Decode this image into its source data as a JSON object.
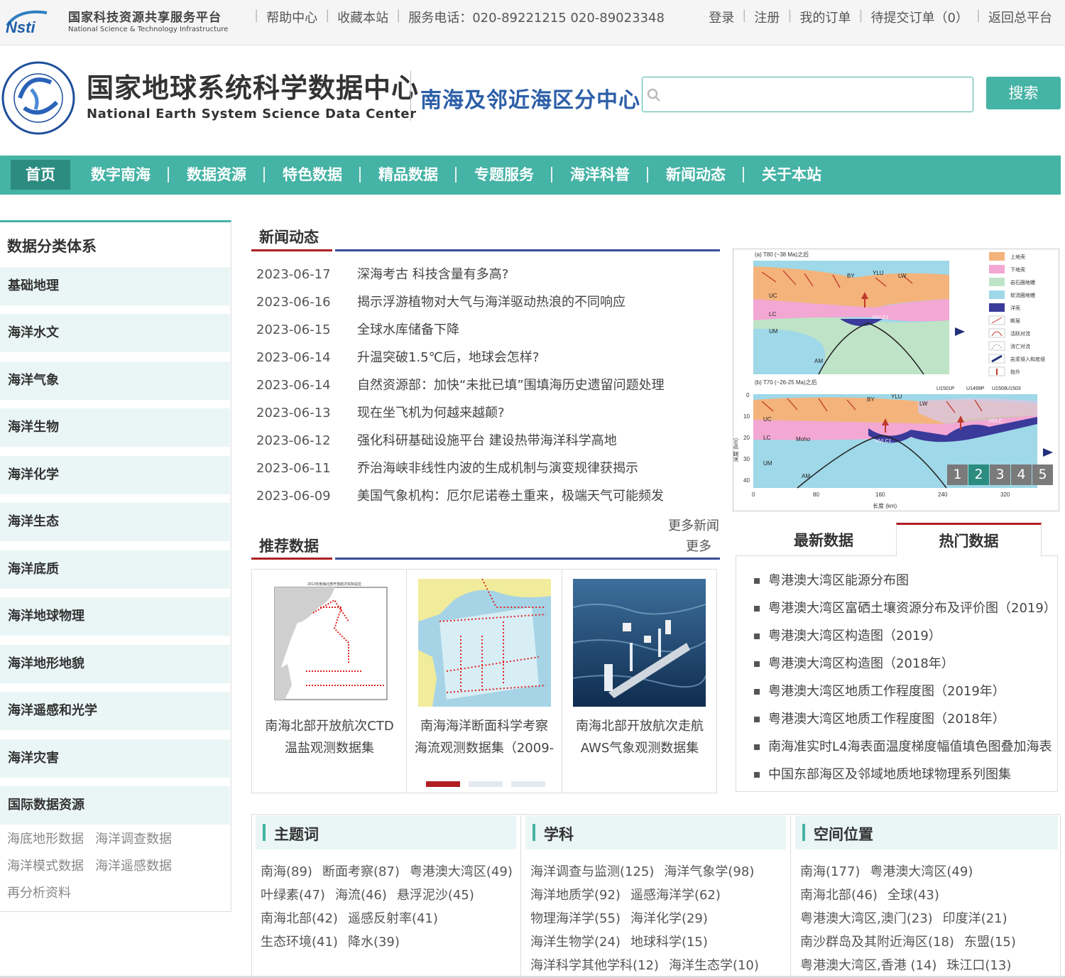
{
  "topbar": {
    "platform_cn": "国家科技资源共享服务平台",
    "platform_en": "National Science & Technology Infrastructure",
    "help": "帮助中心",
    "bookmark": "收藏本站",
    "phone": "服务电话：020-89221215 020-89023348",
    "login": "登录",
    "register": "注册",
    "my_orders": "我的订单",
    "pending_orders": "待提交订单（0）",
    "back_main": "返回总平台"
  },
  "header": {
    "title_cn": "国家地球系统科学数据中心",
    "title_en": "National Earth System Science Data Center",
    "sub_center": "南海及邻近海区分中心",
    "search_placeholder": "",
    "search_button": "搜索"
  },
  "nav": [
    "首页",
    "数字南海",
    "数据资源",
    "特色数据",
    "精品数据",
    "专题服务",
    "海洋科普",
    "新闻动态",
    "关于本站"
  ],
  "sidebar": {
    "title": "数据分类体系",
    "categories": [
      "基础地理",
      "海洋水文",
      "海洋气象",
      "海洋生物",
      "海洋化学",
      "海洋生态",
      "海洋底质",
      "海洋地球物理",
      "海洋地形地貌",
      "海洋遥感和光学",
      "海洋灾害",
      "国际数据资源"
    ],
    "intl_links": [
      [
        "海底地形数据",
        "海洋调查数据"
      ],
      [
        "海洋模式数据",
        "海洋遥感数据"
      ],
      [
        "再分析资料"
      ]
    ]
  },
  "news": {
    "title": "新闻动态",
    "more": "更多新闻",
    "items": [
      {
        "date": "2023-06-17",
        "title": "深海考古 科技含量有多高?"
      },
      {
        "date": "2023-06-16",
        "title": "揭示浮游植物对大气与海洋驱动热浪的不同响应"
      },
      {
        "date": "2023-06-15",
        "title": "全球水库储备下降"
      },
      {
        "date": "2023-06-14",
        "title": "升温突破1.5℃后，地球会怎样?"
      },
      {
        "date": "2023-06-14",
        "title": "自然资源部：加快“未批已填”围填海历史遗留问题处理"
      },
      {
        "date": "2023-06-13",
        "title": "现在坐飞机为何越来越颠?"
      },
      {
        "date": "2023-06-12",
        "title": "强化科研基础设施平台 建设热带海洋科学高地"
      },
      {
        "date": "2023-06-11",
        "title": "乔治海峡非线性内波的生成机制与演变规律获揭示"
      },
      {
        "date": "2023-06-09",
        "title": "美国气象机构：厄尔尼诺卷土重来，极端天气可能频发"
      }
    ]
  },
  "figure": {
    "panel_a": "(a) T80 (~38 Ma)之后",
    "panel_b": "(b) T70 (~26-25 Ma)之后",
    "labels_a": [
      "BY",
      "YLU",
      "LW",
      "UC",
      "LC",
      "UM",
      "HVLC1",
      "AM"
    ],
    "labels_b": [
      "BY",
      "YLU",
      "LW",
      "UC",
      "LC",
      "Moho",
      "HVLC1",
      "UM",
      "AM",
      "HVLC",
      "U1501P",
      "U1499P",
      "U1500",
      "U1503"
    ],
    "legend": [
      "上地壳",
      "下地壳",
      "岩石圈地幔",
      "软流圈地幔",
      "洋壳",
      "断层",
      "活跃对流",
      "消亡对流",
      "岩浆侵入和底侵",
      "抬升"
    ],
    "x_ticks": [
      "0",
      "80",
      "160",
      "240",
      "320"
    ],
    "x_label": "长度 (km)",
    "y_ticks": [
      "0",
      "10",
      "20",
      "30",
      "40"
    ],
    "y_label": "深度 (km)",
    "pages": [
      "1",
      "2",
      "3",
      "4",
      "5"
    ]
  },
  "recommended": {
    "title": "推荐数据",
    "more": "更多",
    "map_title": "2012年南海北部开放航次实际站位",
    "cards": [
      {
        "line1": "南海北部开放航次CTD",
        "line2": "温盐观测数据集"
      },
      {
        "line1": "南海海洋断面科学考察",
        "line2": "海流观测数据集（2009-"
      },
      {
        "line1": "南海北部开放航次走航",
        "line2": "AWS气象观测数据集"
      }
    ]
  },
  "tabs": {
    "latest": "最新数据",
    "hot": "热门数据",
    "hot_items": [
      "粤港澳大湾区能源分布图",
      "粤港澳大湾区富硒土壤资源分布及评价图（2019）",
      "粤港澳大湾区构造图（2019）",
      "粤港澳大湾区构造图（2018年）",
      "粤港澳大湾区地质工作程度图（2019年）",
      "粤港澳大湾区地质工作程度图（2018年）",
      "南海准实时L4海表面温度梯度幅值填色图叠加海表",
      "中国东部海区及邻域地质地球物理系列图集"
    ]
  },
  "tags": {
    "keywords": {
      "title": "主题词",
      "lines": [
        [
          "南海(89)",
          "断面考察(87)",
          "粤港澳大湾区(49)"
        ],
        [
          "叶绿素(47)",
          "海流(46)",
          "悬浮泥沙(45)"
        ],
        [
          "南海北部(42)",
          "遥感反射率(41)"
        ],
        [
          "生态环境(41)",
          "降水(39)"
        ]
      ]
    },
    "disciplines": {
      "title": "学科",
      "lines": [
        [
          "海洋调查与监测(125)",
          "海洋气象学(98)"
        ],
        [
          "海洋地质学(92)",
          "遥感海洋学(62)"
        ],
        [
          "物理海洋学(55)",
          "海洋化学(29)"
        ],
        [
          "海洋生物学(24)",
          "地球科学(15)"
        ],
        [
          "海洋科学其他学科(12)",
          "海洋生态学(10)"
        ]
      ]
    },
    "locations": {
      "title": "空间位置",
      "lines": [
        [
          "南海(177)",
          "粤港澳大湾区(49)"
        ],
        [
          "南海北部(46)",
          "全球(43)"
        ],
        [
          "粤港澳大湾区,澳门(23)",
          "印度洋(21)"
        ],
        [
          "南沙群岛及其附近海区(18)",
          "东盟(15)"
        ],
        [
          "粤港澳大湾区,香港 (14)",
          "珠江口(13)"
        ]
      ]
    }
  }
}
